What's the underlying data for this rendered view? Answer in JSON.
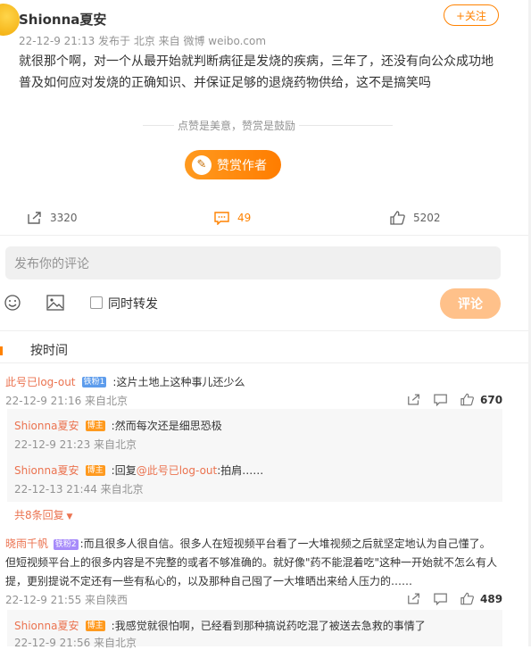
{
  "post": {
    "author": "Shionna夏安",
    "follow_label": "+关注",
    "meta": "22-12-9 21:13  发布于 北京  来自 微博 weibo.com",
    "text": "就很那个啊，对一个从最开始就判断病征是发烧的疾病，三年了，还没有向公众成功地普及如何应对发烧的正确知识、并保证足够的退烧药物供给，这不是搞笑吗",
    "reward_tip": "点赞是美意，赞赏是鼓励",
    "reward_label": "赞赏作者",
    "reposts": "3320",
    "comments": "49",
    "likes": "5202"
  },
  "composer": {
    "placeholder": "发布你的评论",
    "repost_label": "同时转发",
    "send_label": "评论"
  },
  "sort": {
    "label": "按时间"
  },
  "comments": [
    {
      "name": "此号已log-out",
      "badge": "铁粉1",
      "text": ":这片土地上这种事儿还少么",
      "time": "22-12-9 21:16 来自北京",
      "likes": "670",
      "replies": [
        {
          "name": "Shionna夏安",
          "badge": "博主",
          "text": ":然而每次还是细思恐极",
          "time": "22-12-9 21:23 来自北京"
        },
        {
          "name": "Shionna夏安",
          "badge": "博主",
          "prefix": ":回复",
          "mention": "@此号已log-out",
          "text": ":拍肩……",
          "time": "22-12-13 21:44 来自北京"
        }
      ],
      "more": "共8条回复"
    },
    {
      "name": "晓雨千帆",
      "badge": "铁粉2",
      "text": ":而且很多人很自信。很多人在短视频平台看了一大堆视频之后就坚定地认为自己懂了。但短视频平台上的很多内容是不完整的或者不够准确的。就好像\"药不能混着吃\"这种一开始就不怎么有人提，更别提说不定还有一些有私心的，以及那种自己囤了一大堆晒出来给人压力的……",
      "time": "22-12-9 21:55 来自陕西",
      "likes": "489",
      "replies": [
        {
          "name": "Shionna夏安",
          "badge": "博主",
          "text": ":我感觉就很怕啊，已经看到那种搞说药吃混了被送去急救的事情了",
          "time": "22-12-9 21:56 来自北京"
        }
      ]
    }
  ]
}
